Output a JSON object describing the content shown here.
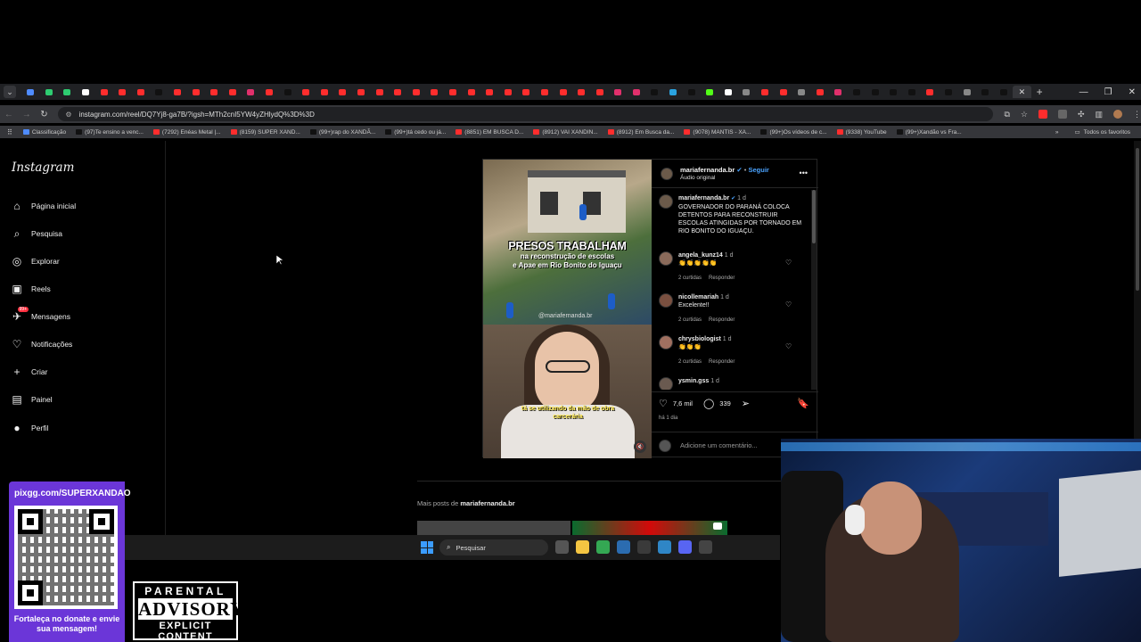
{
  "browser": {
    "tab_colors": [
      "#4f8cff",
      "#2ecc71",
      "#2ecc71",
      "#ffffff",
      "#ff2d2d",
      "#ff2d2d",
      "#ff2d2d",
      "#111111",
      "#ff2d2d",
      "#ff2d2d",
      "#ff2d2d",
      "#ff2d2d",
      "#e1306c",
      "#ff2d2d",
      "#111111",
      "#ff2d2d",
      "#ff2d2d",
      "#ff2d2d",
      "#ff2d2d",
      "#ff2d2d",
      "#ff2d2d",
      "#ff2d2d",
      "#ff2d2d",
      "#ff2d2d",
      "#ff2d2d",
      "#ff2d2d",
      "#ff2d2d",
      "#ff2d2d",
      "#ff2d2d",
      "#ff2d2d",
      "#ff2d2d",
      "#ff2d2d",
      "#e1306c",
      "#e1306c",
      "#111111",
      "#2aa3e0",
      "#111111",
      "#53fc18",
      "#ffffff",
      "#888888",
      "#ff2d2d",
      "#ff2d2d",
      "#888888",
      "#ff2d2d",
      "#e1306c",
      "#111111",
      "#111111",
      "#111111",
      "#111111",
      "#ff2d2d",
      "#111111",
      "#888888",
      "#111111",
      "#111111"
    ],
    "url": "instagram.com/reel/DQ7Yj8-ga7B/?igsh=MTh2cnI5YW4yZHlydQ%3D%3D",
    "bookmarks": [
      {
        "label": "Classificação",
        "color": "#4f8cff"
      },
      {
        "label": "(97)Te ensino a venc...",
        "color": "#111111"
      },
      {
        "label": "(7292) Enéas Metal |...",
        "color": "#ff2d2d"
      },
      {
        "label": "(8159) SUPER XAND...",
        "color": "#ff2d2d"
      },
      {
        "label": "(99+)rap do XANDÃ...",
        "color": "#111111"
      },
      {
        "label": "(99+)tá cedo ou já...",
        "color": "#111111"
      },
      {
        "label": "(8851) EM BUSCA D...",
        "color": "#ff2d2d"
      },
      {
        "label": "(8912) VAI XANDIN...",
        "color": "#ff2d2d"
      },
      {
        "label": "(8912) Em Busca da...",
        "color": "#ff2d2d"
      },
      {
        "label": "(9078) MANTIS - XA...",
        "color": "#ff2d2d"
      },
      {
        "label": "(99+)Os vídeos de c...",
        "color": "#111111"
      },
      {
        "label": "(9338) YouTube",
        "color": "#ff2d2d"
      },
      {
        "label": "(99+)Xandão vs Fra...",
        "color": "#111111"
      }
    ],
    "bookmarks_more": "»",
    "all_bookmarks": "Todos os favoritos"
  },
  "instagram": {
    "logo": "Instagram",
    "nav": [
      {
        "label": "Página inicial",
        "icon": "home-icon",
        "glyph": "⌂"
      },
      {
        "label": "Pesquisa",
        "icon": "search-icon",
        "glyph": "⌕"
      },
      {
        "label": "Explorar",
        "icon": "compass-icon",
        "glyph": "◎"
      },
      {
        "label": "Reels",
        "icon": "reels-icon",
        "glyph": "▣"
      },
      {
        "label": "Mensagens",
        "icon": "messages-icon",
        "glyph": "✈",
        "badge": "99+"
      },
      {
        "label": "Notificações",
        "icon": "heart-icon",
        "glyph": "♡"
      },
      {
        "label": "Criar",
        "icon": "plus-icon",
        "glyph": "+"
      },
      {
        "label": "Painel",
        "icon": "dashboard-icon",
        "glyph": "▤"
      },
      {
        "label": "Perfil",
        "icon": "profile-avatar",
        "glyph": "●"
      }
    ],
    "post": {
      "headline_1": "PRESOS TRABALHAM",
      "headline_2": "na reconstrução de escolas",
      "headline_3": "e Apae em Rio Bonito do Iguaçu",
      "video_handle": "@mariafernanda.br",
      "subtitle": "tá se utilizando da mão de obra carcerária",
      "username": "mariafernanda.br",
      "verified": "✔",
      "follow": "Seguir",
      "audio": "Áudio original",
      "caption_user": "mariafernanda.br",
      "caption_time": "1 d",
      "caption_text": "GOVERNADOR DO PARANÁ COLOCA DETENTOS PARA RECONSTRUIR ESCOLAS ATINGIDAS POR TORNADO EM RIO BONITO DO IGUAÇU.",
      "comments": [
        {
          "user": "angela_kunz14",
          "time": "1 d",
          "text": "👏👏👏👏👏",
          "likes": "2 curtidas",
          "reply": "Responder"
        },
        {
          "user": "nicollemariah",
          "time": "1 d",
          "text": "Excelente!!",
          "likes": "2 curtidas",
          "reply": "Responder"
        },
        {
          "user": "chrysbiologist",
          "time": "1 d",
          "text": "👏👏👏",
          "likes": "2 curtidas",
          "reply": "Responder"
        },
        {
          "user": "ysmin.gss",
          "time": "1 d",
          "text": "",
          "likes": "",
          "reply": ""
        }
      ],
      "like_count": "7,6 mil",
      "comment_count": "339",
      "posted_ago": "há 1 dia",
      "add_comment_placeholder": "Adicione um comentário..."
    },
    "more_posts_prefix": "Mais posts de",
    "more_posts_user": "mariafernanda.br"
  },
  "taskbar": {
    "search_placeholder": "Pesquisar",
    "app_colors": [
      "#555555",
      "#f4c542",
      "#34a853",
      "#2b6cb0",
      "#3a3a3a",
      "#2f86c6",
      "#5865f2",
      "#444444"
    ]
  },
  "overlay": {
    "pix_header": "pixgg.com/SUPERXANDAO",
    "pix_footer": "Fortaleça no donate e envie sua mensagem!",
    "advisory_1": "PARENTAL",
    "advisory_2": "ADVISORY",
    "advisory_3": "EXPLICIT CONTENT"
  }
}
